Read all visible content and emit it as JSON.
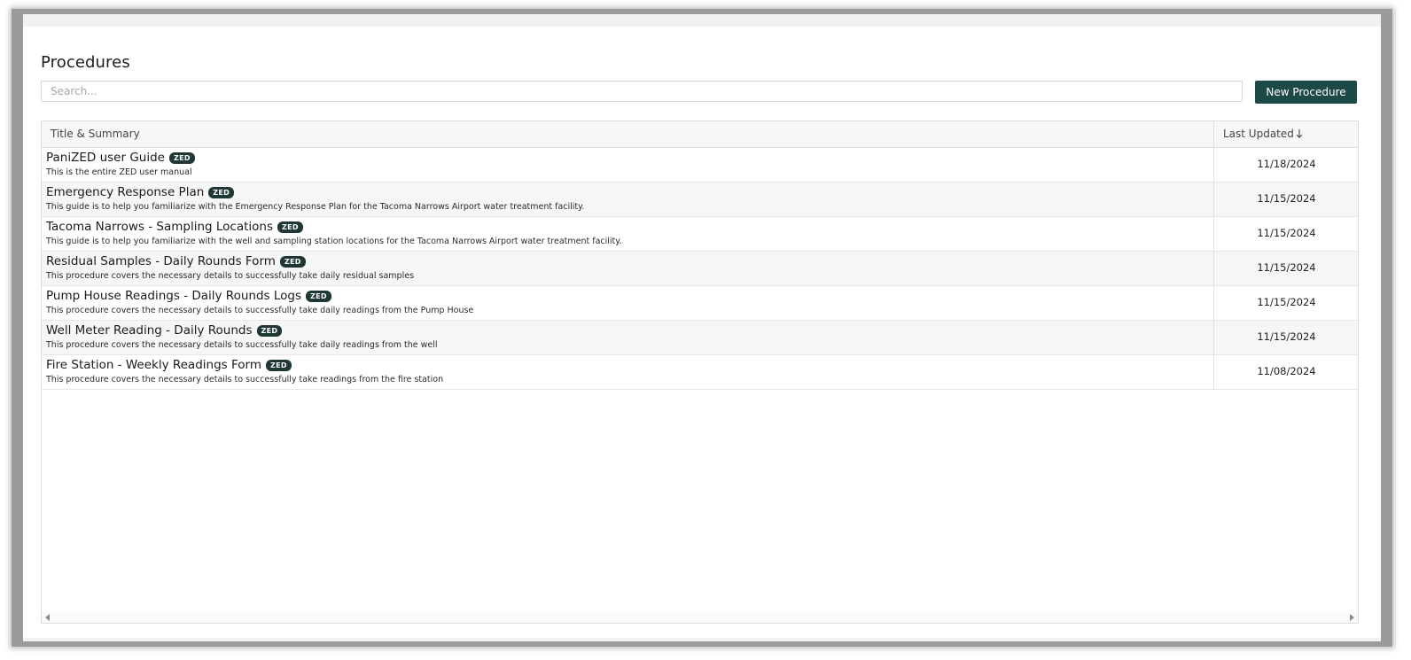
{
  "page": {
    "title": "Procedures"
  },
  "search": {
    "placeholder": "Search...",
    "value": ""
  },
  "toolbar": {
    "new_button_label": "New Procedure"
  },
  "table": {
    "columns": {
      "title": "Title & Summary",
      "date": "Last Updated"
    },
    "sort": {
      "column": "date",
      "direction": "descending",
      "icon": "arrow-down-icon"
    },
    "rows": [
      {
        "title": "PaniZED user Guide",
        "badge": "ZED",
        "summary": "This is the entire ZED user manual",
        "date": "11/18/2024"
      },
      {
        "title": "Emergency Response Plan",
        "badge": "ZED",
        "summary": "This guide is to help you familiarize with the Emergency Response Plan for the Tacoma Narrows Airport water treatment facility.",
        "date": "11/15/2024"
      },
      {
        "title": "Tacoma Narrows - Sampling Locations",
        "badge": "ZED",
        "summary": "This guide is to help you familiarize with the well and sampling station locations for the Tacoma Narrows Airport water treatment facility.",
        "date": "11/15/2024"
      },
      {
        "title": "Residual Samples - Daily Rounds Form",
        "badge": "ZED",
        "summary": "This procedure covers the necessary details to successfully take daily residual samples",
        "date": "11/15/2024"
      },
      {
        "title": "Pump House Readings - Daily Rounds Logs",
        "badge": "ZED",
        "summary": "This procedure covers the necessary details to successfully take daily readings from the Pump House",
        "date": "11/15/2024"
      },
      {
        "title": "Well Meter Reading - Daily Rounds",
        "badge": "ZED",
        "summary": "This procedure covers the necessary details to successfully take daily readings from the well",
        "date": "11/15/2024"
      },
      {
        "title": "Fire Station - Weekly Readings Form",
        "badge": "ZED",
        "summary": "This procedure covers the necessary details to successfully take readings from the fire station",
        "date": "11/08/2024"
      }
    ]
  },
  "colors": {
    "accent": "#1d4a46",
    "badge": "#1f3835",
    "row_alt": "#f6f6f6"
  }
}
